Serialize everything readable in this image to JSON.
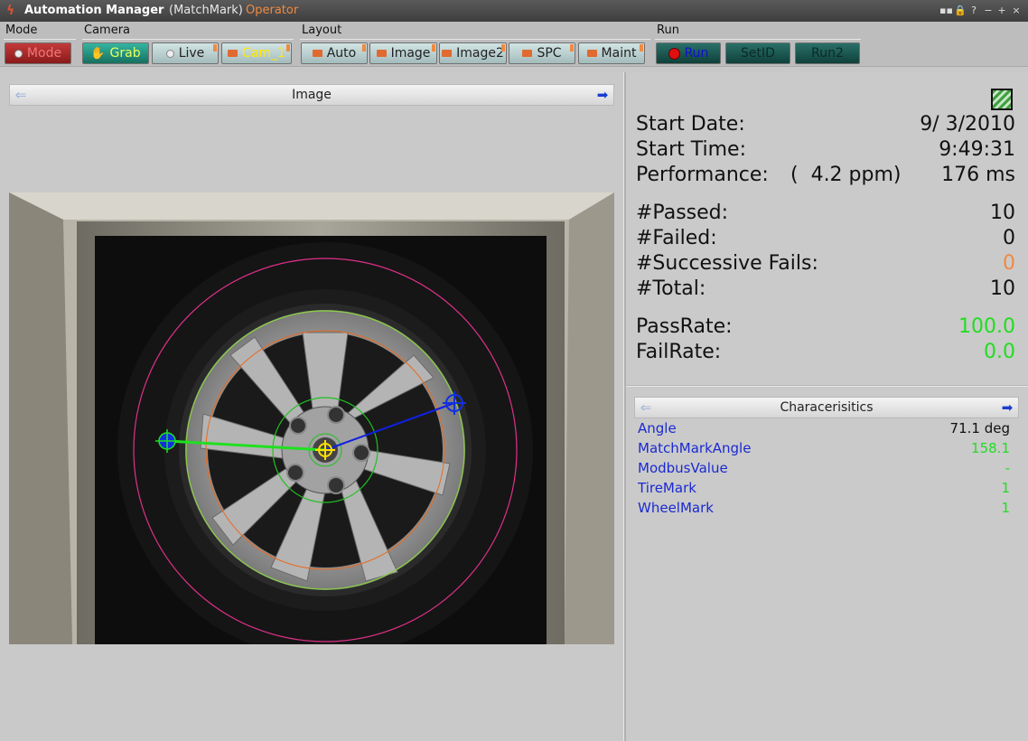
{
  "window": {
    "title": "Automation Manager",
    "subtitle": "(MatchMark)",
    "role": "Operator",
    "controls": [
      "▪▪",
      "🔒",
      "?",
      "−",
      "+",
      "×"
    ]
  },
  "toolbar": {
    "groups": {
      "mode": "Mode",
      "camera": "Camera",
      "layout": "Layout",
      "run": "Run"
    },
    "buttons": {
      "mode": "Mode",
      "grab": "Grab",
      "live": "Live",
      "cam1": "Cam_1",
      "auto": "Auto",
      "image": "Image",
      "image2": "Image2",
      "spc": "SPC",
      "maint": "Maint",
      "run": "Run",
      "setid": "SetID",
      "run2": "Run2"
    }
  },
  "image_panel": {
    "title": "Image"
  },
  "stats": {
    "start_date_label": "Start Date:",
    "start_date": "9/ 3/2010",
    "start_time_label": "Start Time:",
    "start_time": "9:49:31",
    "performance_label": "Performance:",
    "performance_ppm": "(  4.2 ppm)",
    "performance_ms": "176 ms",
    "passed_label": "#Passed:",
    "passed": "10",
    "failed_label": "#Failed:",
    "failed": "0",
    "successive_label": "#Successive Fails:",
    "successive": "0",
    "total_label": "#Total:",
    "total": "10",
    "passrate_label": "PassRate:",
    "passrate": "100.0",
    "failrate_label": "FailRate:",
    "failrate": "0.0"
  },
  "characteristics": {
    "title": "Characerisitics",
    "rows": [
      {
        "label": "Angle",
        "value": "71.1 deg",
        "color": "#111111"
      },
      {
        "label": "MatchMarkAngle",
        "value": "158.1",
        "color": "#22dd22"
      },
      {
        "label": "ModbusValue",
        "value": "-",
        "color": "#22dd22"
      },
      {
        "label": "TireMark",
        "value": "1",
        "color": "#22dd22"
      },
      {
        "label": "WheelMark",
        "value": "1",
        "color": "#22dd22"
      }
    ]
  },
  "colors": {
    "accent_orange": "#f08a40",
    "green_value": "#22dd22",
    "label_blue": "#1a2ad0"
  }
}
